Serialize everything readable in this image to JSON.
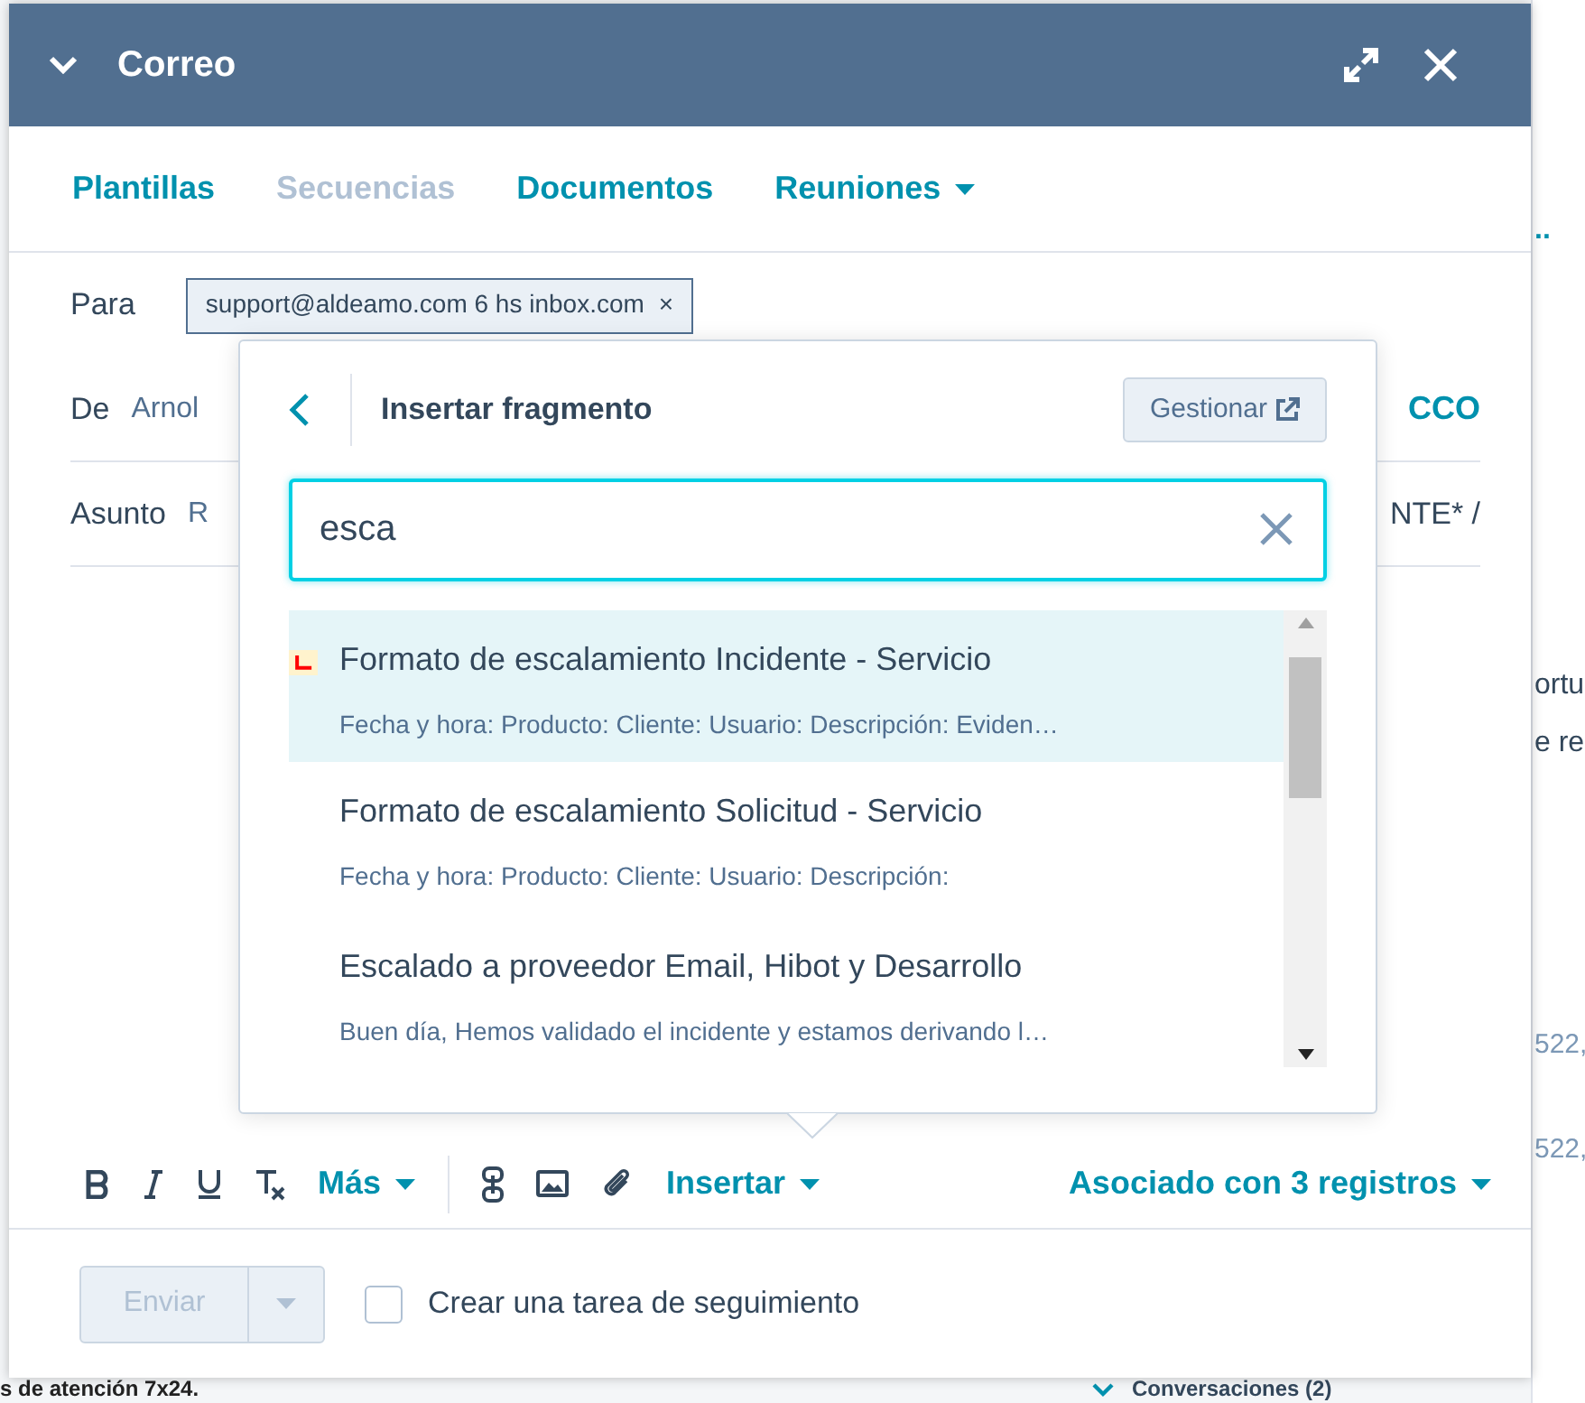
{
  "background": {
    "right_texts": [
      {
        "text": "..",
        "kind": "link"
      },
      {
        "text": "ortu",
        "kind": "plain"
      },
      {
        "text": "e re",
        "kind": "plain"
      },
      {
        "text": "522,",
        "kind": "field"
      },
      {
        "text": "522,",
        "kind": "field"
      }
    ],
    "section": {
      "label": "Conversaciones (2)",
      "expanded": true
    },
    "bottom_text": "s de atención 7x24."
  },
  "window": {
    "title": "Correo"
  },
  "tabs": [
    {
      "label": "Plantillas",
      "disabled": false,
      "dropdown": false
    },
    {
      "label": "Secuencias",
      "disabled": true,
      "dropdown": false
    },
    {
      "label": "Documentos",
      "disabled": false,
      "dropdown": false
    },
    {
      "label": "Reuniones",
      "disabled": false,
      "dropdown": true
    }
  ],
  "fields": [
    {
      "label": "Para",
      "kind": "chip",
      "value": "support@aldeamo.com 6 hs inbox.com",
      "remove": "×"
    },
    {
      "label": "De",
      "kind": "text",
      "value": "Arnol",
      "extra": "CCO"
    },
    {
      "label": "Asunto",
      "kind": "text",
      "value": "R",
      "extra": "NTE* /"
    }
  ],
  "popover": {
    "title": "Insertar fragmento",
    "manage_button": "Gestionar",
    "search": {
      "value": "esca"
    },
    "items": [
      {
        "title": "Formato de escalamiento Incidente - Servicio",
        "preview": "Fecha y hora: Producto: Cliente: Usuario: Descripción: Eviden…",
        "selected": true,
        "marked": true
      },
      {
        "title": "Formato de escalamiento Solicitud - Servicio",
        "preview": "Fecha y hora: Producto: Cliente: Usuario: Descripción:",
        "selected": false,
        "marked": false
      },
      {
        "title": "Escalado a proveedor Email, Hibot y Desarrollo",
        "preview": "Buen día, Hemos validado el incidente y estamos derivando l…",
        "selected": false,
        "marked": false
      }
    ]
  },
  "toolbar": {
    "more": "Más",
    "insert": "Insertar",
    "associated": "Asociado con 3 registros"
  },
  "footer": {
    "send": {
      "label": "Enviar",
      "disabled": true
    },
    "follow_up": {
      "label": "Crear una tarea de seguimiento",
      "checked": false
    }
  }
}
